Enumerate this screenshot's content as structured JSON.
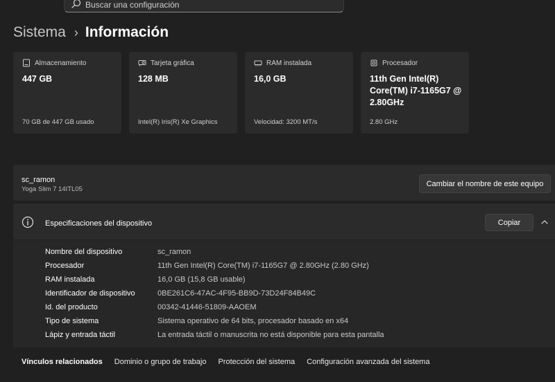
{
  "search": {
    "placeholder": "Buscar una configuración",
    "icon": "search-icon"
  },
  "breadcrumb": {
    "parent": "Sistema",
    "separator": "›",
    "current": "Información"
  },
  "cards": [
    {
      "icon": "storage-icon",
      "label": "Almacenamiento",
      "value": "447 GB",
      "sub": "70 GB de 447 GB usado"
    },
    {
      "icon": "graphics-card-icon",
      "label": "Tarjeta gráfica",
      "value": "128 MB",
      "sub": "Intel(R) Iris(R) Xe Graphics"
    },
    {
      "icon": "ram-icon",
      "label": "RAM instalada",
      "value": "16,0 GB",
      "sub": "Velocidad: 3200 MT/s"
    },
    {
      "icon": "processor-icon",
      "label": "Procesador",
      "value": "11th Gen Intel(R) Core(TM) i7-1165G7 @ 2.80GHz",
      "sub": "2.80 GHz"
    }
  ],
  "device": {
    "name": "sc_ramon",
    "model": "Yoga Slim 7 14ITL05",
    "rename_label": "Cambiar el nombre de este equipo"
  },
  "specs": {
    "title": "Especificaciones del dispositivo",
    "copy_label": "Copiar",
    "rows": [
      {
        "key": "Nombre del dispositivo",
        "value": "sc_ramon"
      },
      {
        "key": "Procesador",
        "value": "11th Gen Intel(R) Core(TM) i7-1165G7 @ 2.80GHz (2.80 GHz)"
      },
      {
        "key": "RAM instalada",
        "value": "16,0 GB (15,8 GB usable)"
      },
      {
        "key": "Identificador de dispositivo",
        "value": "0BE261C6-47AC-4F95-BB9D-73D24F84B49C"
      },
      {
        "key": "Id. del producto",
        "value": "00342-41446-51809-AAOEM"
      },
      {
        "key": "Tipo de sistema",
        "value": "Sistema operativo de 64 bits, procesador basado en x64"
      },
      {
        "key": "Lápiz y entrada táctil",
        "value": "La entrada táctil o manuscrita no está disponible para esta pantalla"
      }
    ]
  },
  "related": {
    "label": "Vínculos relacionados",
    "links": [
      "Dominio o grupo de trabajo",
      "Protección del sistema",
      "Configuración avanzada del sistema"
    ]
  }
}
